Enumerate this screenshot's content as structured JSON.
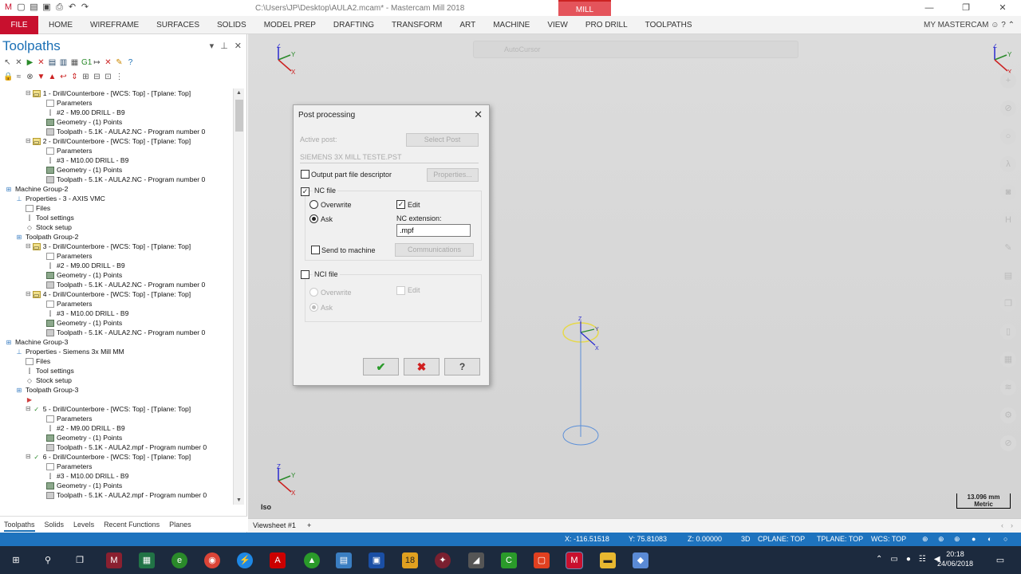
{
  "window": {
    "title": "C:\\Users\\JP\\Desktop\\AULA2.mcam* - Mastercam Mill 2018",
    "context_tab": "MILL",
    "controls": [
      "—",
      "❐",
      "✕"
    ]
  },
  "ribbon": {
    "file": "FILE",
    "tabs": [
      "HOME",
      "WIREFRAME",
      "SURFACES",
      "SOLIDS",
      "MODEL PREP",
      "DRAFTING",
      "TRANSFORM",
      "ART",
      "MACHINE",
      "VIEW",
      "PRO DRILL",
      "TOOLPATHS"
    ],
    "my_mastercam": "MY MASTERCAM"
  },
  "toolpaths_panel": {
    "title": "Toolpaths",
    "bottom_tabs": [
      "Toolpaths",
      "Solids",
      "Levels",
      "Recent Functions",
      "Planes"
    ],
    "tree": [
      {
        "indent": 2,
        "icon": "op",
        "text": "1 - Drill/Counterbore - [WCS: Top] - [Tplane: Top]"
      },
      {
        "indent": 4,
        "icon": "par",
        "text": "Parameters"
      },
      {
        "indent": 4,
        "icon": "tool",
        "text": "#2 - M9.00 DRILL - B9"
      },
      {
        "indent": 4,
        "icon": "geo",
        "text": "Geometry - (1) Points"
      },
      {
        "indent": 4,
        "icon": "tp",
        "text": "Toolpath - 5.1K - AULA2.NC - Program number 0"
      },
      {
        "indent": 2,
        "icon": "op",
        "text": "2 - Drill/Counterbore - [WCS: Top] - [Tplane: Top]"
      },
      {
        "indent": 4,
        "icon": "par",
        "text": "Parameters"
      },
      {
        "indent": 4,
        "icon": "tool",
        "text": "#3 - M10.00 DRILL - B9"
      },
      {
        "indent": 4,
        "icon": "geo",
        "text": "Geometry - (1) Points"
      },
      {
        "indent": 4,
        "icon": "tp",
        "text": "Toolpath - 5.1K - AULA2.NC - Program number 0"
      },
      {
        "indent": 0,
        "icon": "mg",
        "text": "Machine Group-2"
      },
      {
        "indent": 1,
        "icon": "prop",
        "text": "Properties - 3 - AXIS VMC"
      },
      {
        "indent": 2,
        "icon": "par",
        "text": "Files"
      },
      {
        "indent": 2,
        "icon": "tool",
        "text": "Tool settings"
      },
      {
        "indent": 2,
        "icon": "stock",
        "text": "Stock setup"
      },
      {
        "indent": 1,
        "icon": "mg",
        "text": "Toolpath Group-2"
      },
      {
        "indent": 2,
        "icon": "op",
        "text": "3 - Drill/Counterbore - [WCS: Top] - [Tplane: Top]"
      },
      {
        "indent": 4,
        "icon": "par",
        "text": "Parameters"
      },
      {
        "indent": 4,
        "icon": "tool",
        "text": "#2 - M9.00 DRILL - B9"
      },
      {
        "indent": 4,
        "icon": "geo",
        "text": "Geometry - (1) Points"
      },
      {
        "indent": 4,
        "icon": "tp",
        "text": "Toolpath - 5.1K - AULA2.NC - Program number 0"
      },
      {
        "indent": 2,
        "icon": "op",
        "text": "4 - Drill/Counterbore - [WCS: Top] - [Tplane: Top]"
      },
      {
        "indent": 4,
        "icon": "par",
        "text": "Parameters"
      },
      {
        "indent": 4,
        "icon": "tool",
        "text": "#3 - M10.00 DRILL - B9"
      },
      {
        "indent": 4,
        "icon": "geo",
        "text": "Geometry - (1) Points"
      },
      {
        "indent": 4,
        "icon": "tp",
        "text": "Toolpath - 5.1K - AULA2.NC - Program number 0"
      },
      {
        "indent": 0,
        "icon": "mg",
        "text": "Machine Group-3"
      },
      {
        "indent": 1,
        "icon": "prop",
        "text": "Properties - Siemens 3x Mill MM"
      },
      {
        "indent": 2,
        "icon": "par",
        "text": "Files"
      },
      {
        "indent": 2,
        "icon": "tool",
        "text": "Tool settings"
      },
      {
        "indent": 2,
        "icon": "stock",
        "text": "Stock setup"
      },
      {
        "indent": 1,
        "icon": "mg",
        "text": "Toolpath Group-3"
      },
      {
        "indent": 2,
        "icon": "flag",
        "text": ""
      },
      {
        "indent": 2,
        "icon": "check",
        "text": "5 - Drill/Counterbore - [WCS: Top] - [Tplane: Top]"
      },
      {
        "indent": 4,
        "icon": "par",
        "text": "Parameters"
      },
      {
        "indent": 4,
        "icon": "tool",
        "text": "#2 - M9.00 DRILL - B9"
      },
      {
        "indent": 4,
        "icon": "geo",
        "text": "Geometry - (1) Points"
      },
      {
        "indent": 4,
        "icon": "tp",
        "text": "Toolpath - 5.1K - AULA2.mpf - Program number 0"
      },
      {
        "indent": 2,
        "icon": "check",
        "text": "6 - Drill/Counterbore - [WCS: Top] - [Tplane: Top]"
      },
      {
        "indent": 4,
        "icon": "par",
        "text": "Parameters"
      },
      {
        "indent": 4,
        "icon": "tool",
        "text": "#3 - M10.00 DRILL - B9"
      },
      {
        "indent": 4,
        "icon": "geo",
        "text": "Geometry - (1) Points"
      },
      {
        "indent": 4,
        "icon": "tp",
        "text": "Toolpath - 5.1K - AULA2.mpf - Program number 0"
      }
    ]
  },
  "viewport": {
    "autocursor": "AutoCursor",
    "view_label": "Iso",
    "scale_value": "13.096 mm",
    "scale_unit": "Metric",
    "viewsheet_tab": "Viewsheet #1",
    "add_tab": "+"
  },
  "dialog": {
    "title": "Post processing",
    "active_post_label": "Active post:",
    "select_post": "Select Post",
    "post_name": "SIEMENS 3X MILL TESTE.PST",
    "output_descriptor": "Output part file descriptor",
    "properties": "Properties...",
    "nc_file": "NC file",
    "overwrite": "Overwrite",
    "ask": "Ask",
    "edit": "Edit",
    "nc_extension_label": "NC extension:",
    "nc_extension_value": ".mpf",
    "send_to_machine": "Send to machine",
    "communications": "Communications",
    "nci_file": "NCI file",
    "nci_overwrite": "Overwrite",
    "nci_ask": "Ask",
    "nci_edit": "Edit",
    "ok_symbol": "✔",
    "cancel_symbol": "✖",
    "help_symbol": "?"
  },
  "statusbar": {
    "x": "X:  -116.51518",
    "y": "Y:  75.81083",
    "z": "Z:  0.00000",
    "mode": "3D",
    "cplane": "CPLANE: TOP",
    "tplane": "TPLANE: TOP",
    "wcs": "WCS: TOP"
  },
  "taskbar": {
    "time": "20:18",
    "date": "24/06/2018"
  }
}
